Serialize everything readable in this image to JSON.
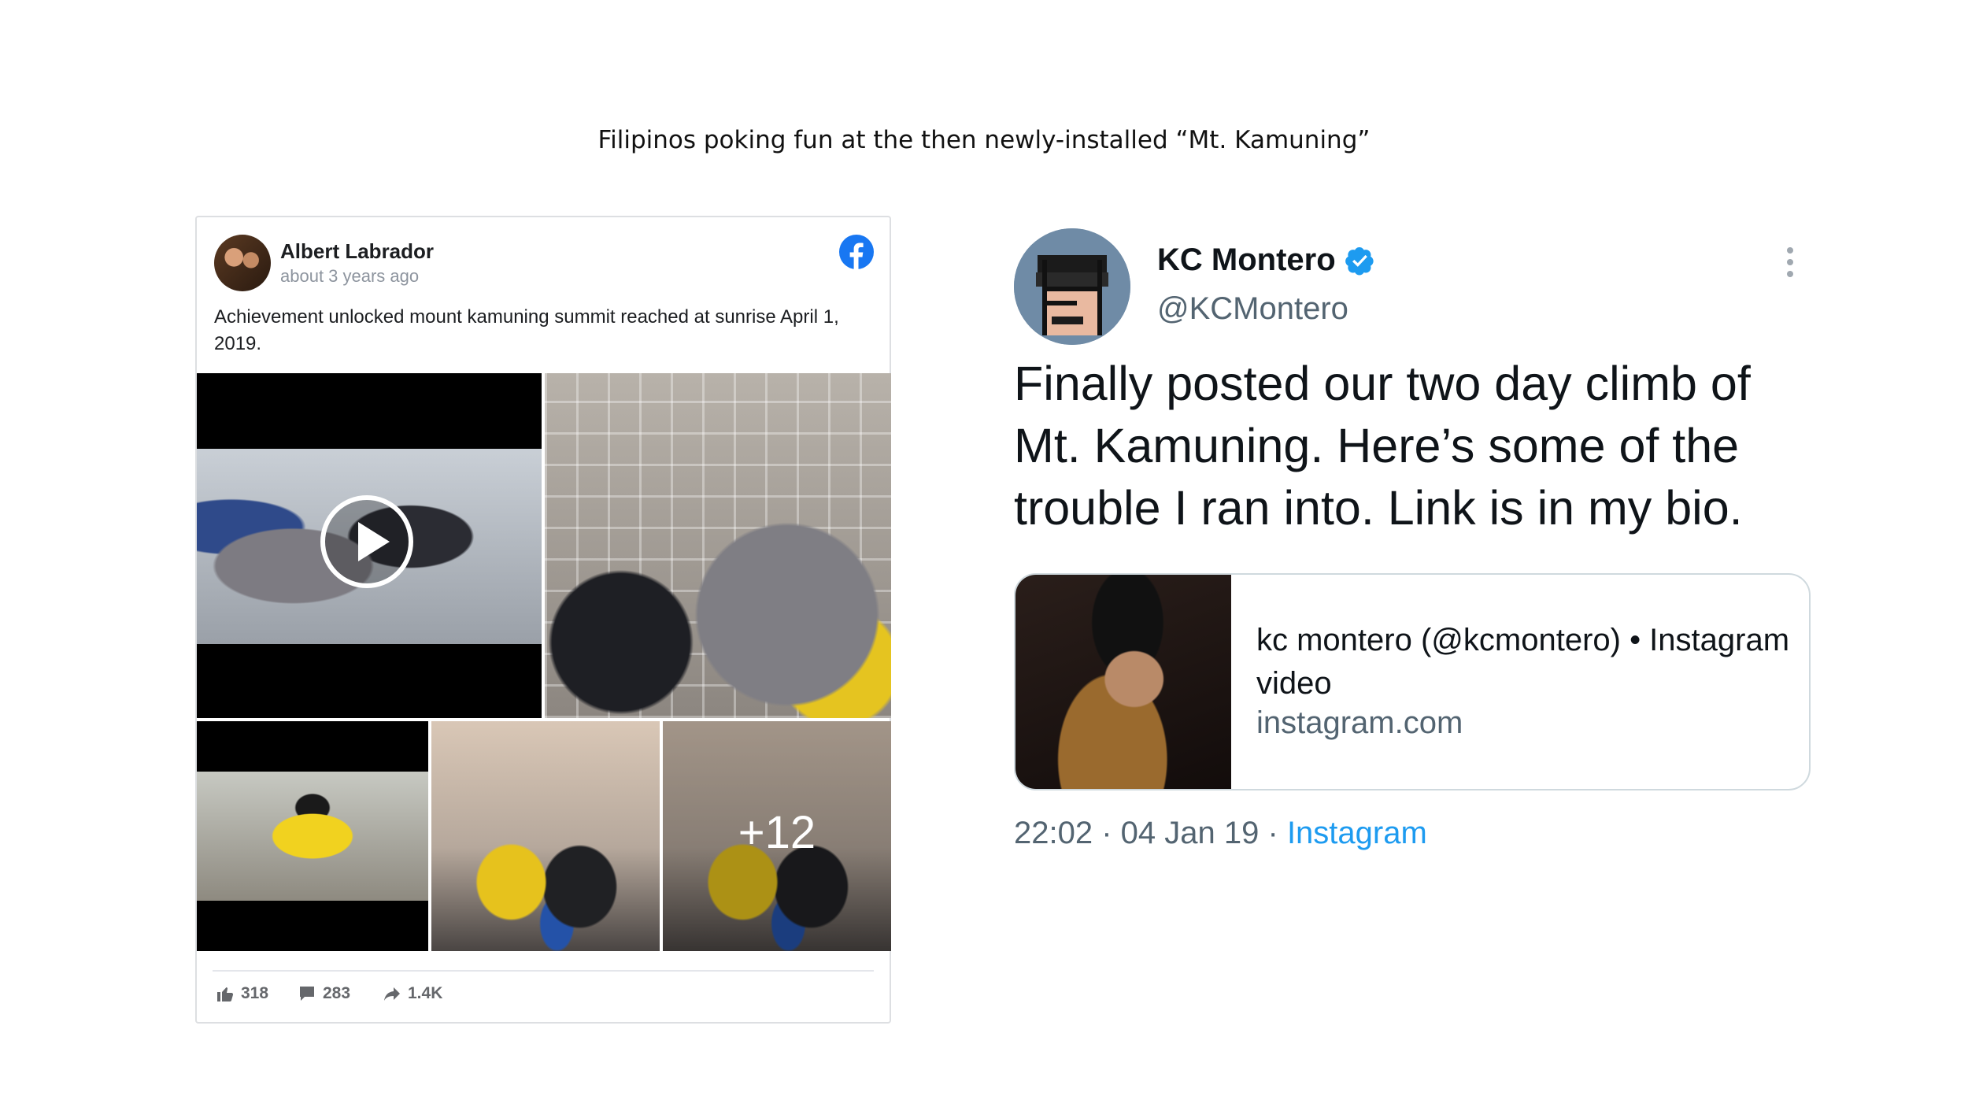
{
  "caption": "Filipinos poking fun at the then newly-installed “Mt. Kamuning”",
  "facebook_post": {
    "author": "Albert Labrador",
    "time": "about 3 years ago",
    "text": "Achievement unlocked mount kamuning summit reached at sunrise April 1, 2019.",
    "more_photos": "+12",
    "likes": "318",
    "comments": "283",
    "shares": "1.4K",
    "colors": {
      "brand": "#1877f2",
      "muted": "#65676b"
    }
  },
  "tweet": {
    "name": "KC Montero",
    "handle": "@KCMontero",
    "text": "Finally posted our two day climb of Mt. Kamuning. Here’s some of the trouble I ran into. Link is in my bio.",
    "link_card": {
      "title": "kc montero (@kcmontero) • Instagram video",
      "domain": "instagram.com"
    },
    "time": "22:02",
    "date": "04 Jan 19",
    "source": "Instagram",
    "colors": {
      "link": "#1d9bf0",
      "verified": "#1d9bf0",
      "muted": "#536471"
    }
  }
}
